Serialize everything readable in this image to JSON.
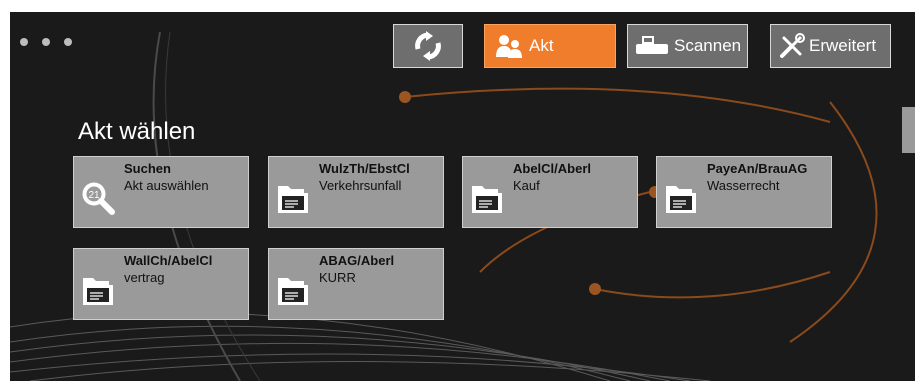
{
  "toolbar": {
    "dots": [
      "",
      "",
      ""
    ],
    "refresh_icon": "refresh-icon",
    "akt_label": "Akt",
    "scan_label": "Scannen",
    "advanced_label": "Erweitert"
  },
  "page": {
    "title": "Akt wählen"
  },
  "cards": [
    {
      "line1": "Suchen",
      "line2": "Akt auswählen",
      "icon": "search-icon",
      "badge": "21"
    },
    {
      "line1": "WulzTh/EbstCl",
      "line2": "Verkehrsunfall",
      "icon": "folder-icon"
    },
    {
      "line1": "AbelCl/Aberl",
      "line2": "Kauf",
      "icon": "folder-icon"
    },
    {
      "line1": "PayeAn/BrauAG",
      "line2": "Wasserrecht",
      "icon": "folder-icon"
    },
    {
      "line1": "WallCh/AbelCl",
      "line2": "vertrag",
      "icon": "folder-icon"
    },
    {
      "line1": "ABAG/Aberl",
      "line2": "KURR",
      "icon": "folder-icon"
    }
  ],
  "colors": {
    "accent": "#ef7d2b",
    "background": "#1a1a1a",
    "card": "#9a9a9a"
  }
}
